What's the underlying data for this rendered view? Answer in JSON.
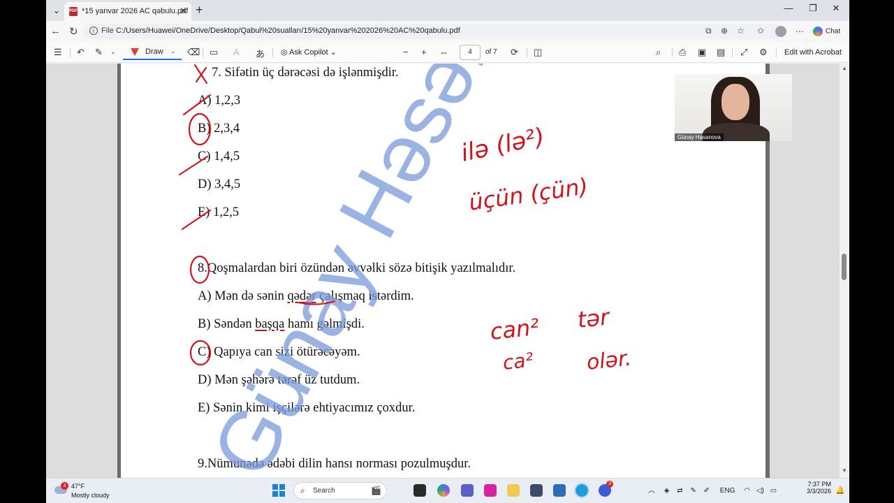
{
  "browser": {
    "tab_title": "*15 yanvar 2026 AC qəbulu.pdf",
    "tab_icon": "pdf-icon",
    "address_scheme_label": "File",
    "url": "C:/Users/Huawei/OneDrive/Desktop/Qabul%20sualları/15%20yanvar%202026%20AC%20qabulu.pdf",
    "chat_label": "Chat"
  },
  "pdf_toolbar": {
    "draw_label": "Draw",
    "ask_copilot_label": "Ask Copilot",
    "page_number": "4",
    "page_total": "of 7",
    "edit_acrobat_label": "Edit with Acrobat"
  },
  "document": {
    "q7": {
      "number": "7.",
      "stem": "Sifətin üç dərəcəsi də işlənmişdir.",
      "options": [
        "A) 1,2,3",
        "B) 2,3,4",
        "C) 1,4,5",
        "D) 3,4,5",
        "E) 1,2,5"
      ]
    },
    "q8": {
      "number": "8.",
      "stem": "Qoşmalardan biri özündən əvvəlki sözə bitişik yazılmalıdır.",
      "option_a_before": "A) Mən də sənin ",
      "option_a_marked": "qədər",
      "option_a_after": " çalışmaq istərdim.",
      "option_b_before": "B) Səndən ",
      "option_b_marked": "başqa",
      "option_b_after": " hamı gəlmişdi.",
      "option_c": "C) Qapıya can sizi ötürəcəyəm.",
      "option_d": "D) Mən şəhərə tərəf üz tutdum.",
      "option_e": "E) Sənin kimi işçilərə ehtiyacımız çoxdur."
    },
    "q9": {
      "stem": "9.Nümunədə ədəbi dilin hansı norması pozulmuşdur."
    },
    "watermark": "Günay Həsənova",
    "handwriting": {
      "note1": "ilə (lə²)",
      "note2": "üçün (çün)",
      "note3": "can²",
      "note4": "ca²",
      "note5": "tər",
      "note6": "olər."
    },
    "ink_color": "#d0141c",
    "watermark_color": "#7a9ad8"
  },
  "webcam": {
    "name": "Günay Hasanova"
  },
  "taskbar": {
    "weather_badge": "3",
    "temperature": "47°F",
    "condition": "Mostly cloudy",
    "search_label": "Search",
    "language": "ENG",
    "time": "7:37 PM",
    "date": "3/3/2026",
    "teams_badge": "3"
  }
}
